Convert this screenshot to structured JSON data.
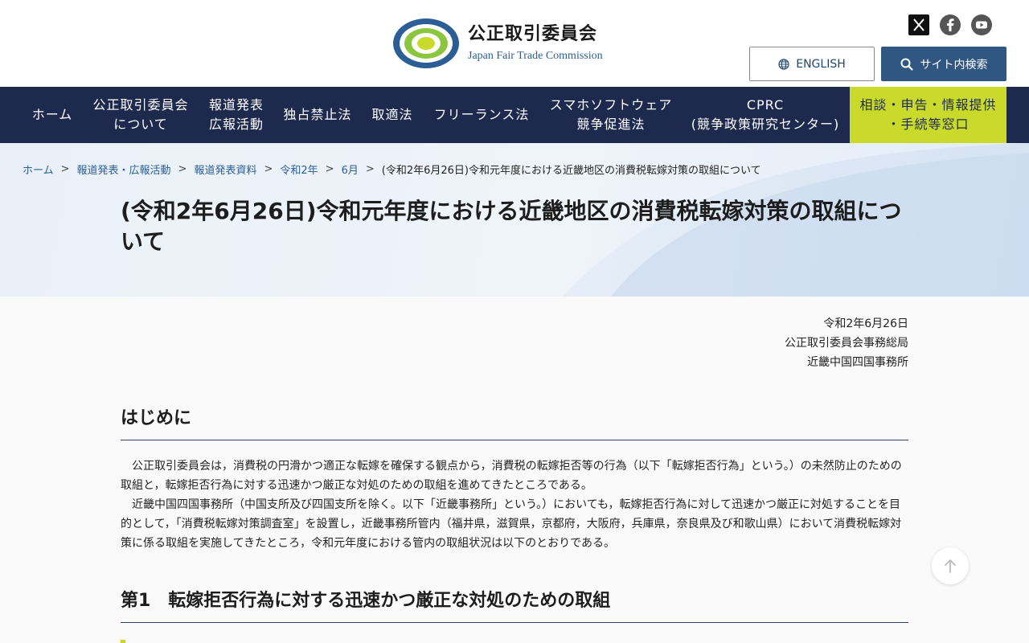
{
  "header": {
    "logo_ja": "公正取引委員会",
    "logo_en": "Japan Fair Trade Commission",
    "english_label": "ENGLISH",
    "search_label": "サイト内検索",
    "social": [
      "x-icon",
      "facebook-icon",
      "youtube-icon"
    ]
  },
  "nav": {
    "items": [
      {
        "label": "ホーム"
      },
      {
        "label": "公正取引委員会\nについて"
      },
      {
        "label": "報道発表\n広報活動"
      },
      {
        "label": "独占禁止法"
      },
      {
        "label": "取適法"
      },
      {
        "label": "フリーランス法"
      },
      {
        "label": "スマホソフトウェア\n競争促進法"
      },
      {
        "label": "CPRC\n(競争政策研究センター)"
      },
      {
        "label": "相談・申告・情報提供\n・手続等窓口"
      }
    ]
  },
  "breadcrumb": {
    "items": [
      "ホーム",
      "報道発表・広報活動",
      "報道発表資料",
      "令和2年",
      "6月"
    ],
    "current": "(令和2年6月26日)令和元年度における近畿地区の消費税転嫁対策の取組について",
    "separator": ">"
  },
  "page": {
    "title": "(令和2年6月26日)令和元年度における近畿地区の消費税転嫁対策の取組について",
    "date": "令和2年6月26日",
    "org1": "公正取引委員会事務総局",
    "org2": "近畿中国四国事務所"
  },
  "sections": {
    "intro_heading": "はじめに",
    "intro_p1": "公正取引委員会は，消費税の円滑かつ適正な転嫁を確保する観点から，消費税の転嫁拒否等の行為（以下「転嫁拒否行為」という。）の未然防止のための取組と，転嫁拒否行為に対する迅速かつ厳正な対処のための取組を進めてきたところである。",
    "intro_p2": "近畿中国四国事務所（中国支所及び四国支所を除く。以下「近畿事務所」という。）においても，転嫁拒否行為に対して迅速かつ厳正に対処することを目的として，「消費税転嫁対策調査室」を設置し，近畿事務所管内（福井県，滋賀県，京都府，大阪府，兵庫県，奈良県及び和歌山県）において消費税転嫁対策に係る取組を実施してきたところ，令和元年度における管内の取組状況は以下のとおりである。",
    "sec1_heading": "第1　転嫁拒否行為に対する迅速かつ厳正な対処のための取組"
  },
  "colors": {
    "nav_bg": "#1e2a4d",
    "accent": "#c9da2a",
    "link": "#2b5e97",
    "search_bg": "#2f5781"
  }
}
